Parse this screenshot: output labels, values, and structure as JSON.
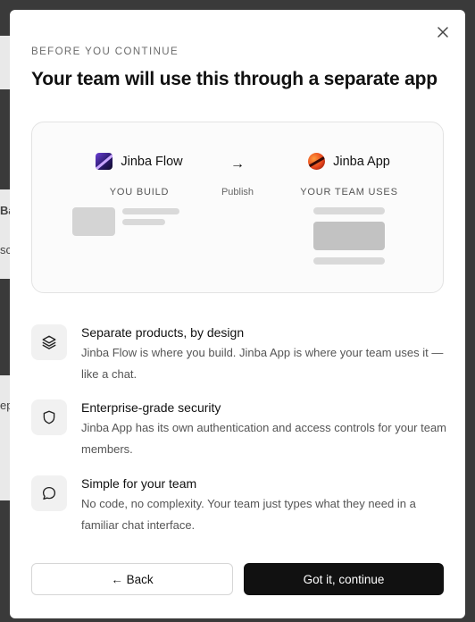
{
  "modal": {
    "eyebrow": "BEFORE YOU CONTINUE",
    "title": "Your team will use this through a separate app",
    "close_icon": "close-icon"
  },
  "diagram": {
    "left": {
      "name": "Jinba Flow",
      "caption": "YOU BUILD",
      "logo": "jinba-flow-logo"
    },
    "middle": {
      "arrow": "→",
      "label": "Publish"
    },
    "right": {
      "name": "Jinba App",
      "caption": "YOUR TEAM USES",
      "logo": "jinba-app-logo"
    }
  },
  "features": [
    {
      "icon": "layers-icon",
      "title": "Separate products, by design",
      "desc": "Jinba Flow is where you build. Jinba App is where your team uses it — like a chat."
    },
    {
      "icon": "shield-icon",
      "title": "Enterprise-grade security",
      "desc": "Jinba App has its own authentication and access controls for your team members."
    },
    {
      "icon": "chat-bubble-icon",
      "title": "Simple for your team",
      "desc": "No code, no complexity. Your team just types what they need in a familiar chat interface."
    }
  ],
  "buttons": {
    "back": "← Back",
    "continue": "Got it, continue"
  },
  "background": {
    "fragments": [
      "Ba",
      "sc",
      "ep"
    ]
  }
}
